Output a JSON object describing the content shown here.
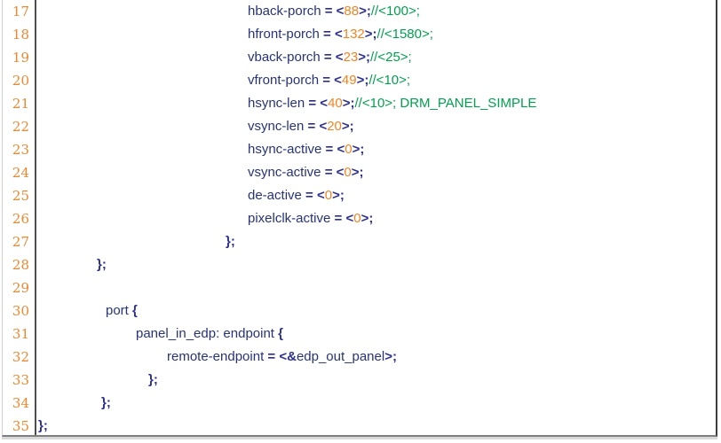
{
  "editor": {
    "colors": {
      "line_number": "#F0862D",
      "plain": "#26337C",
      "sym": "#2B2F90",
      "num": "#F5831F",
      "com": "#00A14E",
      "gutter_separator": "#4d4d4d",
      "border_right": "#3d3d3d",
      "border_bottom": "#7f7f7f"
    },
    "lines": [
      {
        "number": "17",
        "indent": 237,
        "tokens": [
          [
            "plain",
            "hback-porch "
          ],
          [
            "sym",
            "= <"
          ],
          [
            "num",
            "88"
          ],
          [
            "sym",
            ">;"
          ],
          [
            "com",
            "//<100>;"
          ]
        ]
      },
      {
        "number": "18",
        "indent": 237,
        "tokens": [
          [
            "plain",
            "hfront-porch "
          ],
          [
            "sym",
            "= <"
          ],
          [
            "num",
            "132"
          ],
          [
            "sym",
            ">;"
          ],
          [
            "com",
            "//<1580>;"
          ]
        ]
      },
      {
        "number": "19",
        "indent": 237,
        "tokens": [
          [
            "plain",
            "vback-porch "
          ],
          [
            "sym",
            "= <"
          ],
          [
            "num",
            "23"
          ],
          [
            "sym",
            ">;"
          ],
          [
            "com",
            "//<25>;"
          ]
        ]
      },
      {
        "number": "20",
        "indent": 237,
        "tokens": [
          [
            "plain",
            "vfront-porch "
          ],
          [
            "sym",
            "= <"
          ],
          [
            "num",
            "49"
          ],
          [
            "sym",
            ">;"
          ],
          [
            "com",
            "//<10>;"
          ]
        ]
      },
      {
        "number": "21",
        "indent": 237,
        "tokens": [
          [
            "plain",
            "hsync-len "
          ],
          [
            "sym",
            "= <"
          ],
          [
            "num",
            "40"
          ],
          [
            "sym",
            ">;"
          ],
          [
            "com",
            "//<10>; DRM_PANEL_SIMPLE"
          ]
        ]
      },
      {
        "number": "22",
        "indent": 237,
        "tokens": [
          [
            "plain",
            "vsync-len "
          ],
          [
            "sym",
            "= <"
          ],
          [
            "num",
            "20"
          ],
          [
            "sym",
            ">;"
          ]
        ]
      },
      {
        "number": "23",
        "indent": 237,
        "tokens": [
          [
            "plain",
            "hsync-active "
          ],
          [
            "sym",
            "= <"
          ],
          [
            "num",
            "0"
          ],
          [
            "sym",
            ">;"
          ]
        ]
      },
      {
        "number": "24",
        "indent": 237,
        "tokens": [
          [
            "plain",
            "vsync-active "
          ],
          [
            "sym",
            "= <"
          ],
          [
            "num",
            "0"
          ],
          [
            "sym",
            ">;"
          ]
        ]
      },
      {
        "number": "25",
        "indent": 237,
        "tokens": [
          [
            "plain",
            "de-active "
          ],
          [
            "sym",
            "= <"
          ],
          [
            "num",
            "0"
          ],
          [
            "sym",
            ">;"
          ]
        ]
      },
      {
        "number": "26",
        "indent": 237,
        "tokens": [
          [
            "plain",
            "pixelclk-active "
          ],
          [
            "sym",
            "= <"
          ],
          [
            "num",
            "0"
          ],
          [
            "sym",
            ">;"
          ]
        ]
      },
      {
        "number": "27",
        "indent": 212,
        "tokens": [
          [
            "sym",
            "};"
          ]
        ]
      },
      {
        "number": "28",
        "indent": 67,
        "tokens": [
          [
            "sym",
            "};"
          ]
        ]
      },
      {
        "number": "29",
        "indent": 0,
        "tokens": []
      },
      {
        "number": "30",
        "indent": 77,
        "tokens": [
          [
            "plain",
            "port "
          ],
          [
            "sym",
            "{"
          ]
        ]
      },
      {
        "number": "31",
        "indent": 111,
        "tokens": [
          [
            "plain",
            "panel_in_edp: endpoint "
          ],
          [
            "sym",
            "{"
          ]
        ]
      },
      {
        "number": "32",
        "indent": 146,
        "tokens": [
          [
            "plain",
            "remote-endpoint "
          ],
          [
            "sym",
            "= <&"
          ],
          [
            "plain",
            "edp_out_panel"
          ],
          [
            "sym",
            ">;"
          ]
        ]
      },
      {
        "number": "33",
        "indent": 125,
        "tokens": [
          [
            "sym",
            "};"
          ]
        ]
      },
      {
        "number": "34",
        "indent": 72,
        "tokens": [
          [
            "sym",
            "};"
          ]
        ]
      },
      {
        "number": "35",
        "indent": 1,
        "tokens": [
          [
            "sym",
            "};"
          ]
        ]
      }
    ]
  }
}
